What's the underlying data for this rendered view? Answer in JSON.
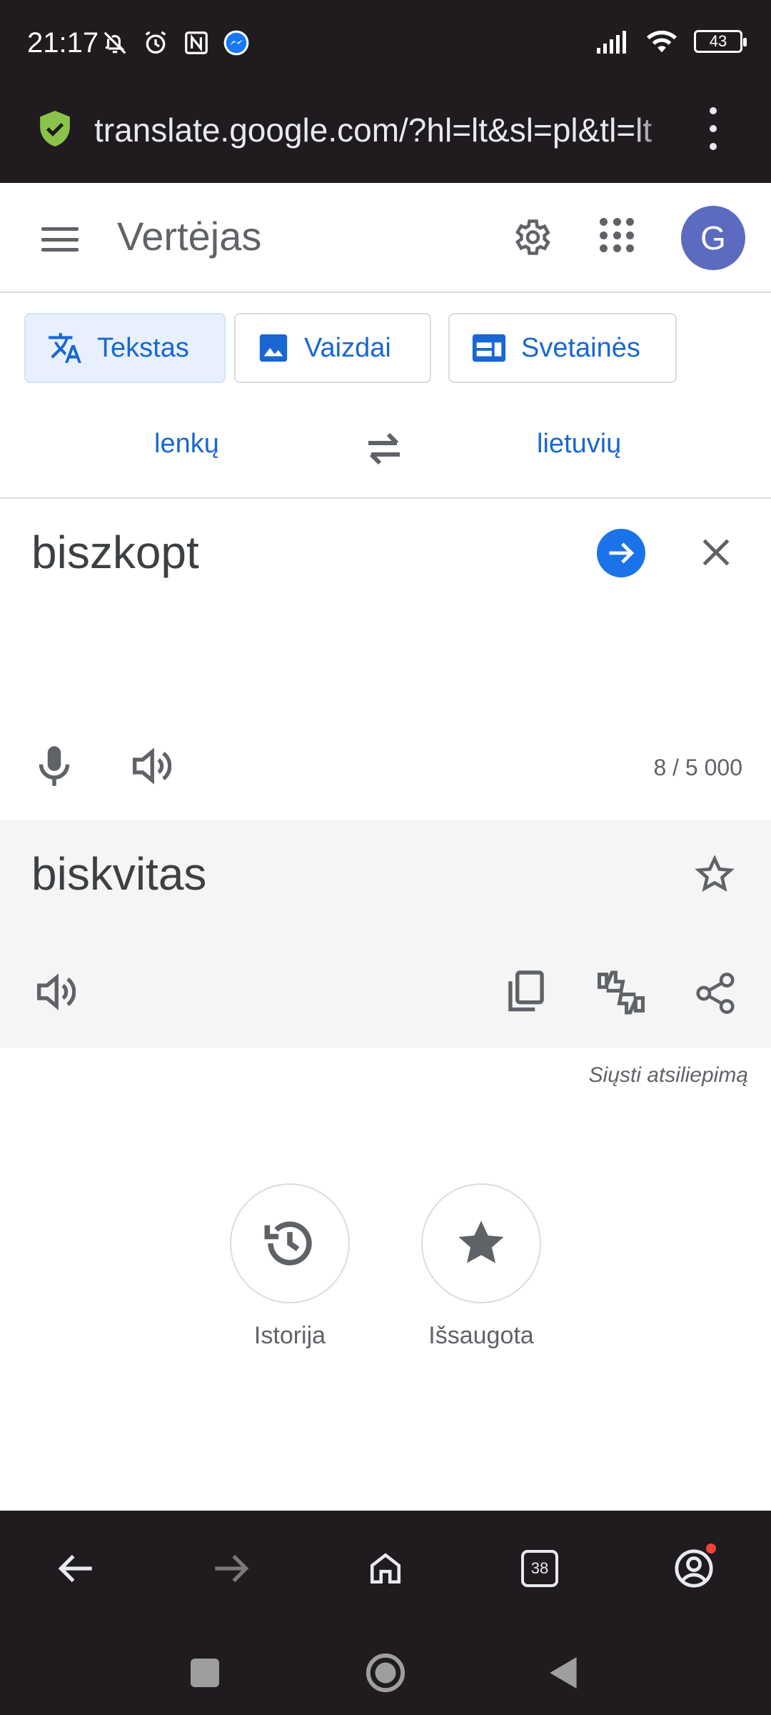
{
  "status_bar": {
    "time": "21:17",
    "battery": "43",
    "icons": [
      "bell-off-icon",
      "alarm-icon",
      "nfc-icon",
      "messenger-icon",
      "signal-icon",
      "wifi-icon",
      "battery-icon"
    ]
  },
  "browser": {
    "url": "translate.google.com/?hl=lt&sl=pl&tl=lt",
    "tab_count": "38"
  },
  "header": {
    "title": "Vertėjas",
    "avatar_letter": "G"
  },
  "modes": [
    {
      "label": "Tekstas",
      "active": true
    },
    {
      "label": "Vaizdai",
      "active": false
    },
    {
      "label": "Svetainės",
      "active": false
    }
  ],
  "languages": {
    "source": "lenkų",
    "target": "lietuvių"
  },
  "source": {
    "text": "biszkopt",
    "counter": "8 / 5 000"
  },
  "result": {
    "text": "biskvitas",
    "feedback": "Siųsti atsiliepimą"
  },
  "shortcuts": {
    "history_label": "Istorija",
    "saved_label": "Išsaugota"
  },
  "colors": {
    "accent": "#1a73e8",
    "link": "#1967d2",
    "avatar": "#5c6bc0",
    "browser_chrome": "#1f1b1f",
    "secure_shield": "#8bc34a",
    "notification_dot": "#f44336"
  }
}
